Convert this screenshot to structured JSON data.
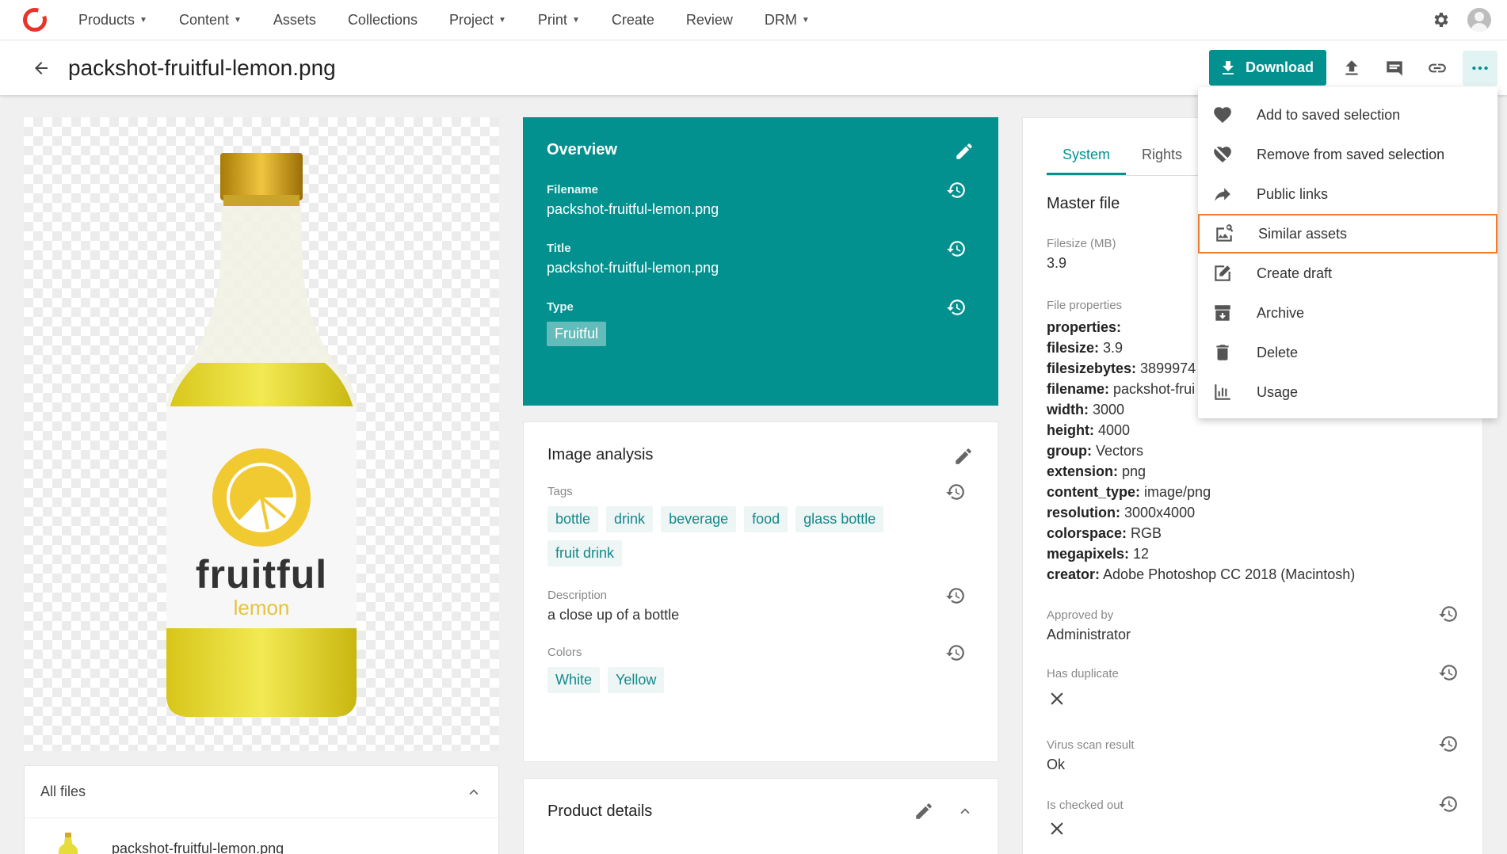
{
  "nav": {
    "items": [
      {
        "label": "Products",
        "dropdown": true
      },
      {
        "label": "Content",
        "dropdown": true
      },
      {
        "label": "Assets",
        "dropdown": false
      },
      {
        "label": "Collections",
        "dropdown": false
      },
      {
        "label": "Project",
        "dropdown": true
      },
      {
        "label": "Print",
        "dropdown": true
      },
      {
        "label": "Create",
        "dropdown": false
      },
      {
        "label": "Review",
        "dropdown": false
      },
      {
        "label": "DRM",
        "dropdown": true
      }
    ]
  },
  "titlebar": {
    "title": "packshot-fruitful-lemon.png",
    "download_label": "Download"
  },
  "preview": {
    "brand": "fruitful",
    "variant": "lemon"
  },
  "allfiles": {
    "title": "All files",
    "file": "packshot-fruitful-lemon.png"
  },
  "overview": {
    "title": "Overview",
    "filename_label": "Filename",
    "filename": "packshot-fruitful-lemon.png",
    "title_label": "Title",
    "title_value": "packshot-fruitful-lemon.png",
    "type_label": "Type",
    "type_value": "Fruitful"
  },
  "analysis": {
    "title": "Image analysis",
    "tags_label": "Tags",
    "tags": [
      "bottle",
      "drink",
      "beverage",
      "food",
      "glass bottle",
      "fruit drink"
    ],
    "description_label": "Description",
    "description": "a close up of a bottle",
    "colors_label": "Colors",
    "colors": [
      "White",
      "Yellow"
    ]
  },
  "product": {
    "title": "Product details"
  },
  "rightpanel": {
    "tabs": [
      "System",
      "Rights"
    ],
    "master_file": "Master file",
    "filesize_label": "Filesize (MB)",
    "filesize": "3.9",
    "fileprops_label": "File properties",
    "props": [
      {
        "k": "properties:",
        "v": ""
      },
      {
        "k": "filesize:",
        "v": " 3.9"
      },
      {
        "k": "filesizebytes:",
        "v": " 3899974"
      },
      {
        "k": "filename:",
        "v": " packshot-frui"
      },
      {
        "k": "width:",
        "v": " 3000"
      },
      {
        "k": "height:",
        "v": " 4000"
      },
      {
        "k": "group:",
        "v": " Vectors"
      },
      {
        "k": "extension:",
        "v": " png"
      },
      {
        "k": "content_type:",
        "v": " image/png"
      },
      {
        "k": "resolution:",
        "v": " 3000x4000"
      },
      {
        "k": "colorspace:",
        "v": " RGB"
      },
      {
        "k": "megapixels:",
        "v": " 12"
      },
      {
        "k": "creator:",
        "v": " Adobe Photoshop CC 2018 (Macintosh)"
      }
    ],
    "approved_label": "Approved by",
    "approved": "Administrator",
    "duplicate_label": "Has duplicate",
    "virus_label": "Virus scan result",
    "virus": "Ok",
    "checked_label": "Is checked out"
  },
  "menu": {
    "items": [
      {
        "label": "Add to saved selection",
        "icon": "heart-icon"
      },
      {
        "label": "Remove from saved selection",
        "icon": "heart-broken-icon"
      },
      {
        "label": "Public links",
        "icon": "share-arrow-icon"
      },
      {
        "label": "Similar assets",
        "icon": "image-search-icon"
      },
      {
        "label": "Create draft",
        "icon": "edit-box-icon"
      },
      {
        "label": "Archive",
        "icon": "archive-icon"
      },
      {
        "label": "Delete",
        "icon": "trash-icon"
      },
      {
        "label": "Usage",
        "icon": "usage-chart-icon"
      }
    ]
  },
  "colors": {
    "accent": "#03918f",
    "highlight": "#f07d2e",
    "brand_red": "#e8342a"
  }
}
